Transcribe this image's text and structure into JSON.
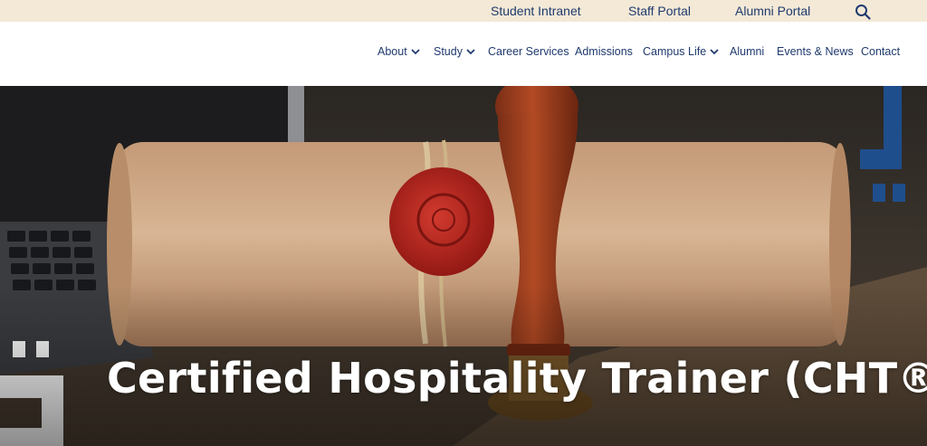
{
  "utility_nav": {
    "links": [
      {
        "label": "Student Intranet"
      },
      {
        "label": "Staff Portal"
      },
      {
        "label": "Alumni Portal"
      }
    ],
    "search_icon": "search-icon"
  },
  "main_nav": {
    "items": [
      {
        "label": "About",
        "has_dropdown": true
      },
      {
        "label": "Study",
        "has_dropdown": true
      },
      {
        "label": "Career Services",
        "has_dropdown": false
      },
      {
        "label": "Admissions",
        "has_dropdown": false
      },
      {
        "label": "Campus Life",
        "has_dropdown": true
      },
      {
        "label": "Alumni",
        "has_dropdown": false
      },
      {
        "label": "Events & News",
        "has_dropdown": false
      },
      {
        "label": "Contact",
        "has_dropdown": false
      }
    ]
  },
  "hero": {
    "title": "Certified Hospitality Trainer (CHT®)"
  },
  "colors": {
    "utility_bar_bg": "#f3e9d6",
    "nav_text": "#1f3a6e",
    "brand_blue": "#1f4e8c",
    "hero_text": "#ffffff"
  }
}
